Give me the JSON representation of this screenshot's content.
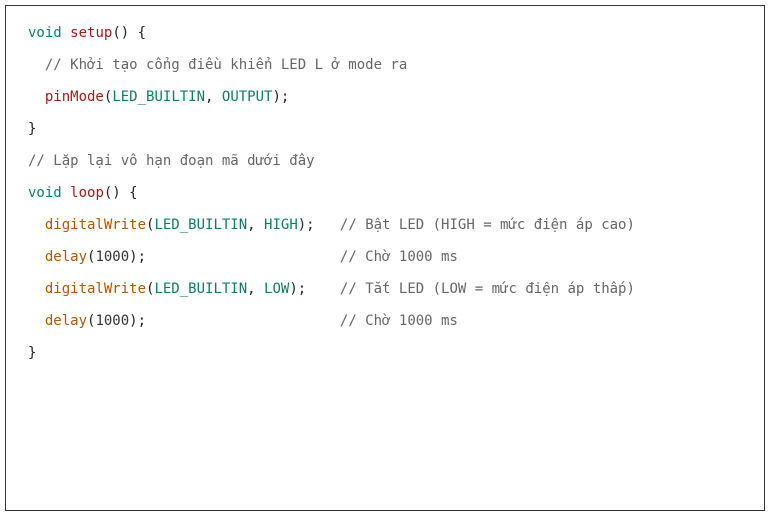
{
  "code": {
    "lines": [
      {
        "indent": 0,
        "segments": [
          {
            "cls": "kw",
            "text": "void"
          },
          {
            "cls": "plain",
            "text": " "
          },
          {
            "cls": "fn-def",
            "text": "setup"
          },
          {
            "cls": "plain",
            "text": "() {"
          }
        ]
      },
      {
        "indent": 1,
        "segments": [
          {
            "cls": "comment",
            "text": "// Khởi tạo cổng điều khiển LED L ở mode ra"
          }
        ]
      },
      {
        "indent": 1,
        "segments": [
          {
            "cls": "fn-def",
            "text": "pinMode"
          },
          {
            "cls": "plain",
            "text": "("
          },
          {
            "cls": "const",
            "text": "LED_BUILTIN"
          },
          {
            "cls": "plain",
            "text": ", "
          },
          {
            "cls": "const",
            "text": "OUTPUT"
          },
          {
            "cls": "plain",
            "text": ");"
          }
        ]
      },
      {
        "indent": 0,
        "segments": [
          {
            "cls": "plain",
            "text": "}"
          }
        ]
      },
      {
        "indent": 0,
        "segments": [
          {
            "cls": "comment",
            "text": "// Lặp lại vô hạn đoạn mã dưới đây"
          }
        ]
      },
      {
        "indent": 0,
        "segments": [
          {
            "cls": "kw",
            "text": "void"
          },
          {
            "cls": "plain",
            "text": " "
          },
          {
            "cls": "fn-def",
            "text": "loop"
          },
          {
            "cls": "plain",
            "text": "() {"
          }
        ]
      },
      {
        "indent": 1,
        "segments": [
          {
            "cls": "fn-call",
            "text": "digitalWrite"
          },
          {
            "cls": "plain",
            "text": "("
          },
          {
            "cls": "const",
            "text": "LED_BUILTIN"
          },
          {
            "cls": "plain",
            "text": ", "
          },
          {
            "cls": "const",
            "text": "HIGH"
          },
          {
            "cls": "plain",
            "text": ");   "
          },
          {
            "cls": "comment",
            "text": "// Bật LED (HIGH = mức điện áp cao)"
          }
        ]
      },
      {
        "indent": 1,
        "segments": [
          {
            "cls": "fn-call",
            "text": "delay"
          },
          {
            "cls": "plain",
            "text": "("
          },
          {
            "cls": "num",
            "text": "1000"
          },
          {
            "cls": "plain",
            "text": ");                       "
          },
          {
            "cls": "comment",
            "text": "// Chờ 1000 ms"
          }
        ]
      },
      {
        "indent": 1,
        "segments": [
          {
            "cls": "fn-call",
            "text": "digitalWrite"
          },
          {
            "cls": "plain",
            "text": "("
          },
          {
            "cls": "const",
            "text": "LED_BUILTIN"
          },
          {
            "cls": "plain",
            "text": ", "
          },
          {
            "cls": "const",
            "text": "LOW"
          },
          {
            "cls": "plain",
            "text": ");    "
          },
          {
            "cls": "comment",
            "text": "// Tắt LED (LOW = mức điện áp thấp)"
          }
        ]
      },
      {
        "indent": 1,
        "segments": [
          {
            "cls": "fn-call",
            "text": "delay"
          },
          {
            "cls": "plain",
            "text": "("
          },
          {
            "cls": "num",
            "text": "1000"
          },
          {
            "cls": "plain",
            "text": ");                       "
          },
          {
            "cls": "comment",
            "text": "// Chờ 1000 ms"
          }
        ]
      },
      {
        "indent": 0,
        "segments": [
          {
            "cls": "plain",
            "text": "}"
          }
        ]
      }
    ],
    "indent_unit": "  "
  }
}
